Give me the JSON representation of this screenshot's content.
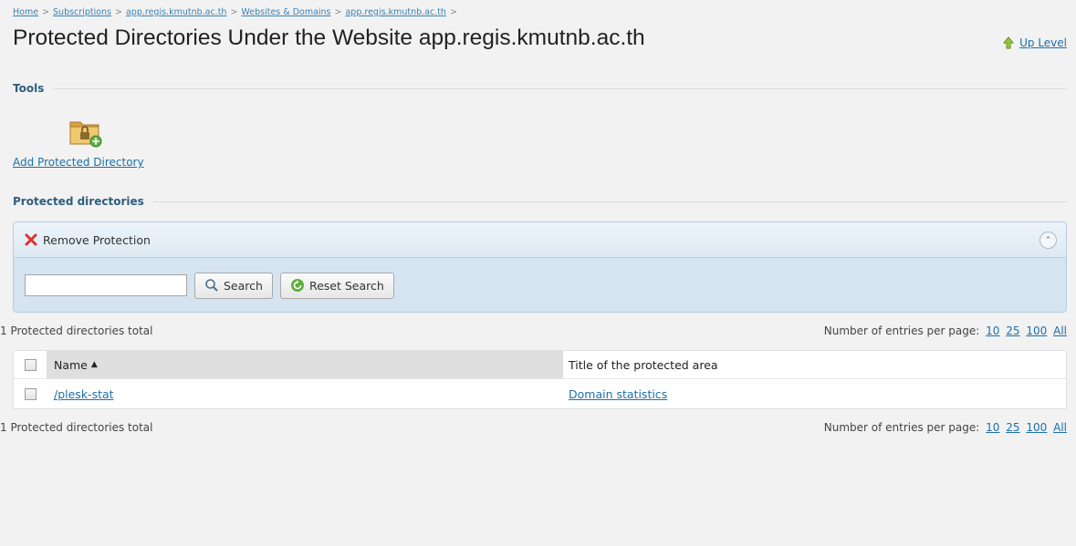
{
  "breadcrumb": [
    {
      "label": "Home"
    },
    {
      "label": "Subscriptions"
    },
    {
      "label": "app.regis.kmutnb.ac.th"
    },
    {
      "label": "Websites & Domains"
    },
    {
      "label": "app.regis.kmutnb.ac.th"
    }
  ],
  "breadcrumb_separator": ">",
  "page": {
    "title": "Protected Directories Under the Website app.regis.kmutnb.ac.th",
    "up_level": "Up Level"
  },
  "tools": {
    "heading": "Tools",
    "add_protected_directory": "Add Protected Directory",
    "icon": "locked-folder-add-icon"
  },
  "protected": {
    "heading": "Protected directories",
    "remove_label": "Remove Protection",
    "search_value": "",
    "search_label": "Search",
    "reset_label": "Reset Search"
  },
  "list": {
    "total_text": "1 Protected directories total",
    "per_page_label": "Number of entries per page:",
    "per_page_options": [
      "10",
      "25",
      "100",
      "All"
    ],
    "columns": {
      "name": "Name",
      "title": "Title of the protected area"
    },
    "sort_indicator": "▲",
    "rows": [
      {
        "name": "/plesk-stat",
        "title": "Domain statistics"
      }
    ]
  },
  "colors": {
    "link": "#1e6fa8",
    "panel_bg": "#d5e4f0",
    "section_heading": "#2e5e7e"
  }
}
